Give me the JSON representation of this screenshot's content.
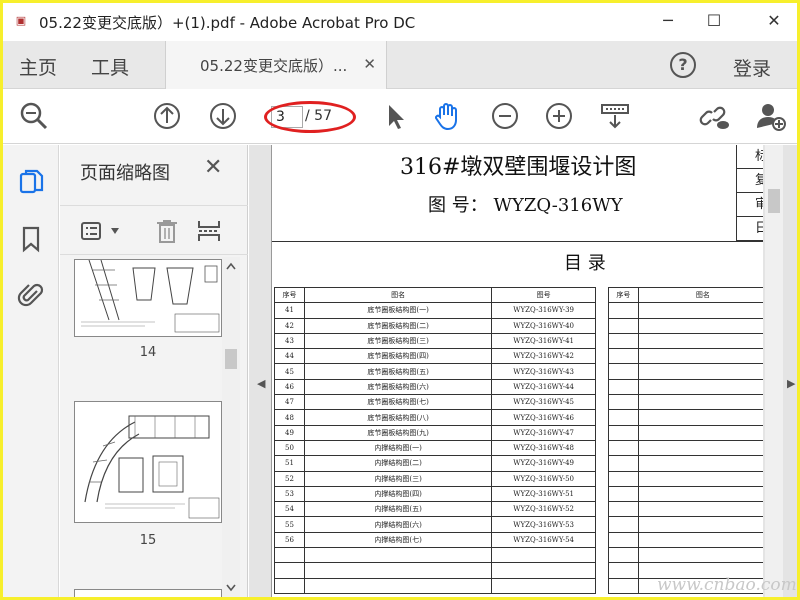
{
  "window": {
    "title": "05.22变更交底版）+(1).pdf - Adobe Acrobat Pro DC",
    "minimize": "─",
    "maximize": "☐",
    "close": "✕"
  },
  "tabs": {
    "home": "主页",
    "tools": "工具",
    "doc_tab": "05.22变更交底版）...",
    "doc_tab_close": "✕",
    "help": "?",
    "login": "登录"
  },
  "toolbar": {
    "current_page": "3",
    "total_pages": "/ 57",
    "icons": [
      "search-icon",
      "page-up-icon",
      "page-down-icon",
      "select-cursor-icon",
      "hand-tool-icon",
      "zoom-out-icon",
      "zoom-in-icon",
      "scroll-mode-icon",
      "share-link-icon",
      "add-user-icon"
    ],
    "accent_color": "#1a73e8",
    "highlight_color": "#e02020"
  },
  "thumb_panel": {
    "title": "页面缩略图",
    "close": "✕",
    "thumbnails": [
      {
        "label": "14"
      },
      {
        "label": "15"
      }
    ]
  },
  "document": {
    "title": "316#墩双壁围堰设计图",
    "number": "图 号： WYZQ-316WY",
    "toc_heading": "目    录",
    "side_cells": [
      "标",
      "复",
      "审",
      "日"
    ],
    "table_headers": [
      "序号",
      "图名",
      "图号"
    ],
    "table2_headers": [
      "序号",
      "图名"
    ],
    "rows": [
      {
        "no": "41",
        "name": "底节圈板结构图(一)",
        "code": "WYZQ-316WY-39"
      },
      {
        "no": "42",
        "name": "底节圈板结构图(二)",
        "code": "WYZQ-316WY-40"
      },
      {
        "no": "43",
        "name": "底节圈板结构图(三)",
        "code": "WYZQ-316WY-41"
      },
      {
        "no": "44",
        "name": "底节圈板结构图(四)",
        "code": "WYZQ-316WY-42"
      },
      {
        "no": "45",
        "name": "底节圈板结构图(五)",
        "code": "WYZQ-316WY-43"
      },
      {
        "no": "46",
        "name": "底节圈板结构图(六)",
        "code": "WYZQ-316WY-44"
      },
      {
        "no": "47",
        "name": "底节圈板结构图(七)",
        "code": "WYZQ-316WY-45"
      },
      {
        "no": "48",
        "name": "底节圈板结构图(八)",
        "code": "WYZQ-316WY-46"
      },
      {
        "no": "49",
        "name": "底节圈板结构图(九)",
        "code": "WYZQ-316WY-47"
      },
      {
        "no": "50",
        "name": "内撑结构图(一)",
        "code": "WYZQ-316WY-48"
      },
      {
        "no": "51",
        "name": "内撑结构图(二)",
        "code": "WYZQ-316WY-49"
      },
      {
        "no": "52",
        "name": "内撑结构图(三)",
        "code": "WYZQ-316WY-50"
      },
      {
        "no": "53",
        "name": "内撑结构图(四)",
        "code": "WYZQ-316WY-51"
      },
      {
        "no": "54",
        "name": "内撑结构图(五)",
        "code": "WYZQ-316WY-52"
      },
      {
        "no": "55",
        "name": "内撑结构图(六)",
        "code": "WYZQ-316WY-53"
      },
      {
        "no": "56",
        "name": "内撑结构图(七)",
        "code": "WYZQ-316WY-54"
      }
    ]
  },
  "watermark": "www.cnbao.com"
}
